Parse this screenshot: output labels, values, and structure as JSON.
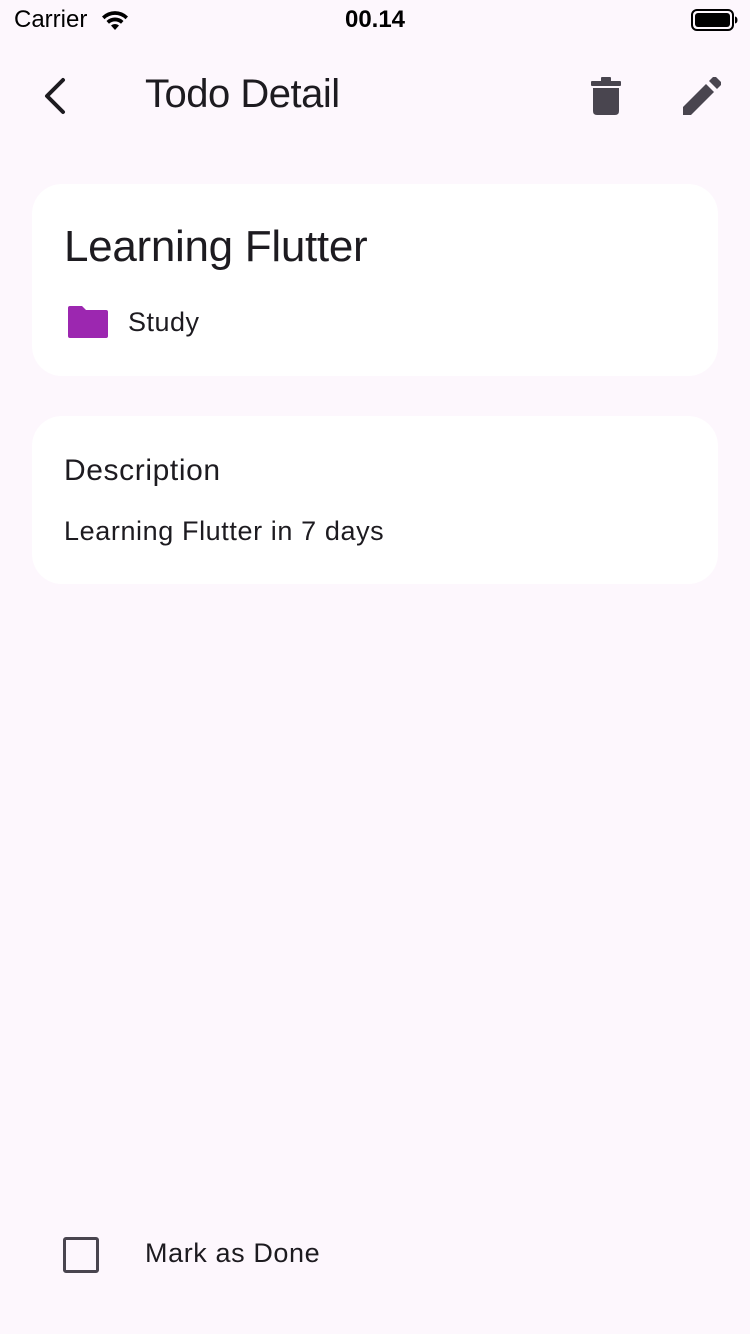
{
  "status_bar": {
    "carrier": "Carrier",
    "time": "00.14",
    "icons": [
      "wifi-icon",
      "battery-icon"
    ]
  },
  "app_bar": {
    "title": "Todo Detail",
    "icons": [
      "back-arrow-icon",
      "trash-icon",
      "pencil-icon"
    ]
  },
  "todo": {
    "title": "Learning Flutter",
    "category": {
      "label": "Study",
      "icon": "folder-icon",
      "color": "#9C27B0"
    }
  },
  "description": {
    "heading": "Description",
    "text": "Learning Flutter in 7 days"
  },
  "footer": {
    "mark_done_label": "Mark as Done",
    "checked": false
  },
  "colors": {
    "background": "#FDF7FD",
    "card": "#FFFFFF",
    "icon": "#49454F",
    "accent": "#9C27B0"
  }
}
